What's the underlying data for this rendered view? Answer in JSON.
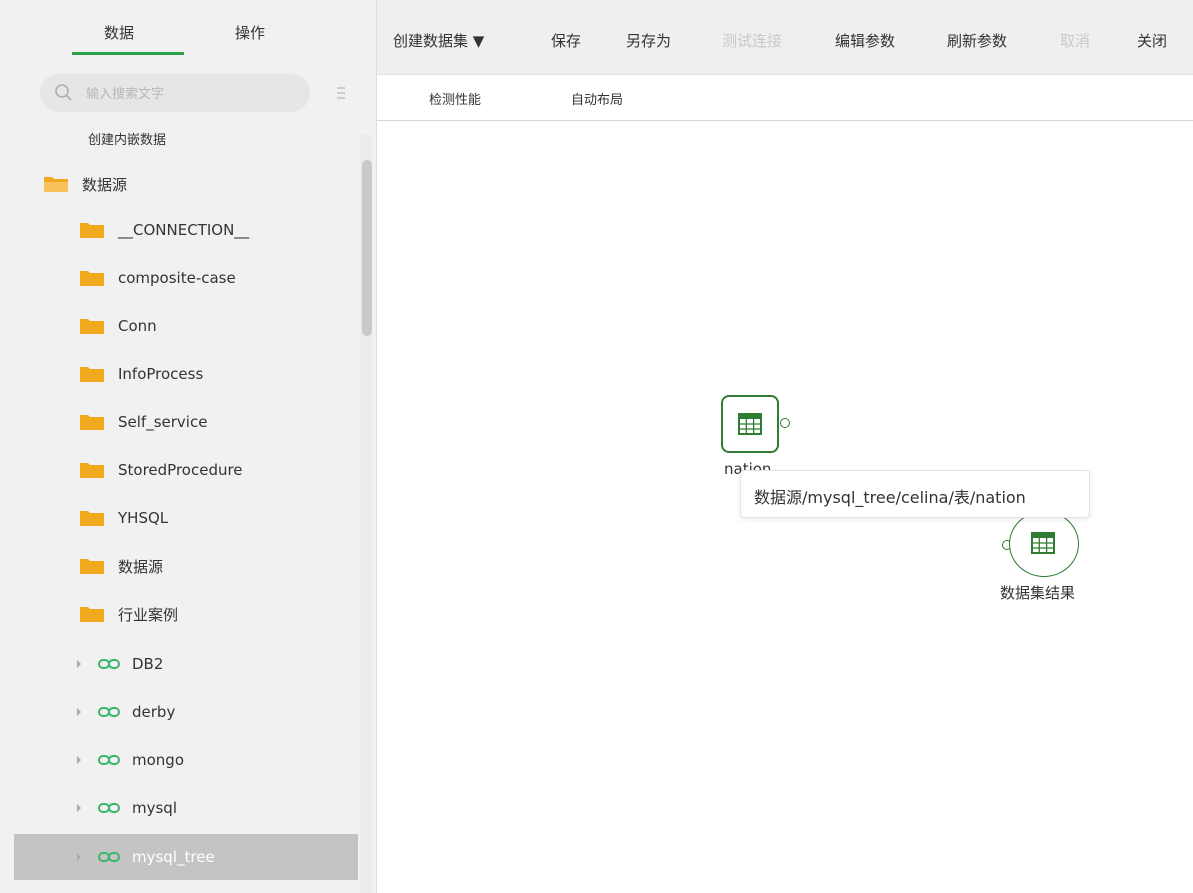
{
  "left_panel": {
    "tabs": [
      {
        "label": "数据"
      },
      {
        "label": "操作"
      }
    ],
    "search": {
      "placeholder": "输入搜索文字"
    },
    "tree": [
      {
        "label": "创建内嵌数据"
      },
      {
        "label": "数据源"
      },
      {
        "label": "__CONNECTION__"
      },
      {
        "label": "composite-case"
      },
      {
        "label": "Conn"
      },
      {
        "label": "InfoProcess"
      },
      {
        "label": "Self_service"
      },
      {
        "label": "StoredProcedure"
      },
      {
        "label": "YHSQL"
      },
      {
        "label": "数据源"
      },
      {
        "label": "行业案例"
      },
      {
        "label": "DB2"
      },
      {
        "label": "derby"
      },
      {
        "label": "mongo"
      },
      {
        "label": "mysql"
      },
      {
        "label": "mysql_tree"
      }
    ]
  },
  "toolbar": {
    "create_dataset": "创建数据集 ▼",
    "save": "保存",
    "save_as": "另存为",
    "test_connection": "测试连接",
    "edit_params": "编辑参数",
    "refresh_params": "刷新参数",
    "cancel": "取消",
    "close": "关闭"
  },
  "subbar": {
    "detect_performance": "检测性能",
    "auto_layout": "自动布局"
  },
  "canvas": {
    "node_source_label": "nation",
    "tooltip": "数据源/mysql_tree/celina/表/nation",
    "node_result_label": "数据集结果"
  },
  "colors": {
    "accent_green": "#2aa248",
    "folder_orange": "#f2a81d",
    "selected_row": "#c4c4c4"
  }
}
